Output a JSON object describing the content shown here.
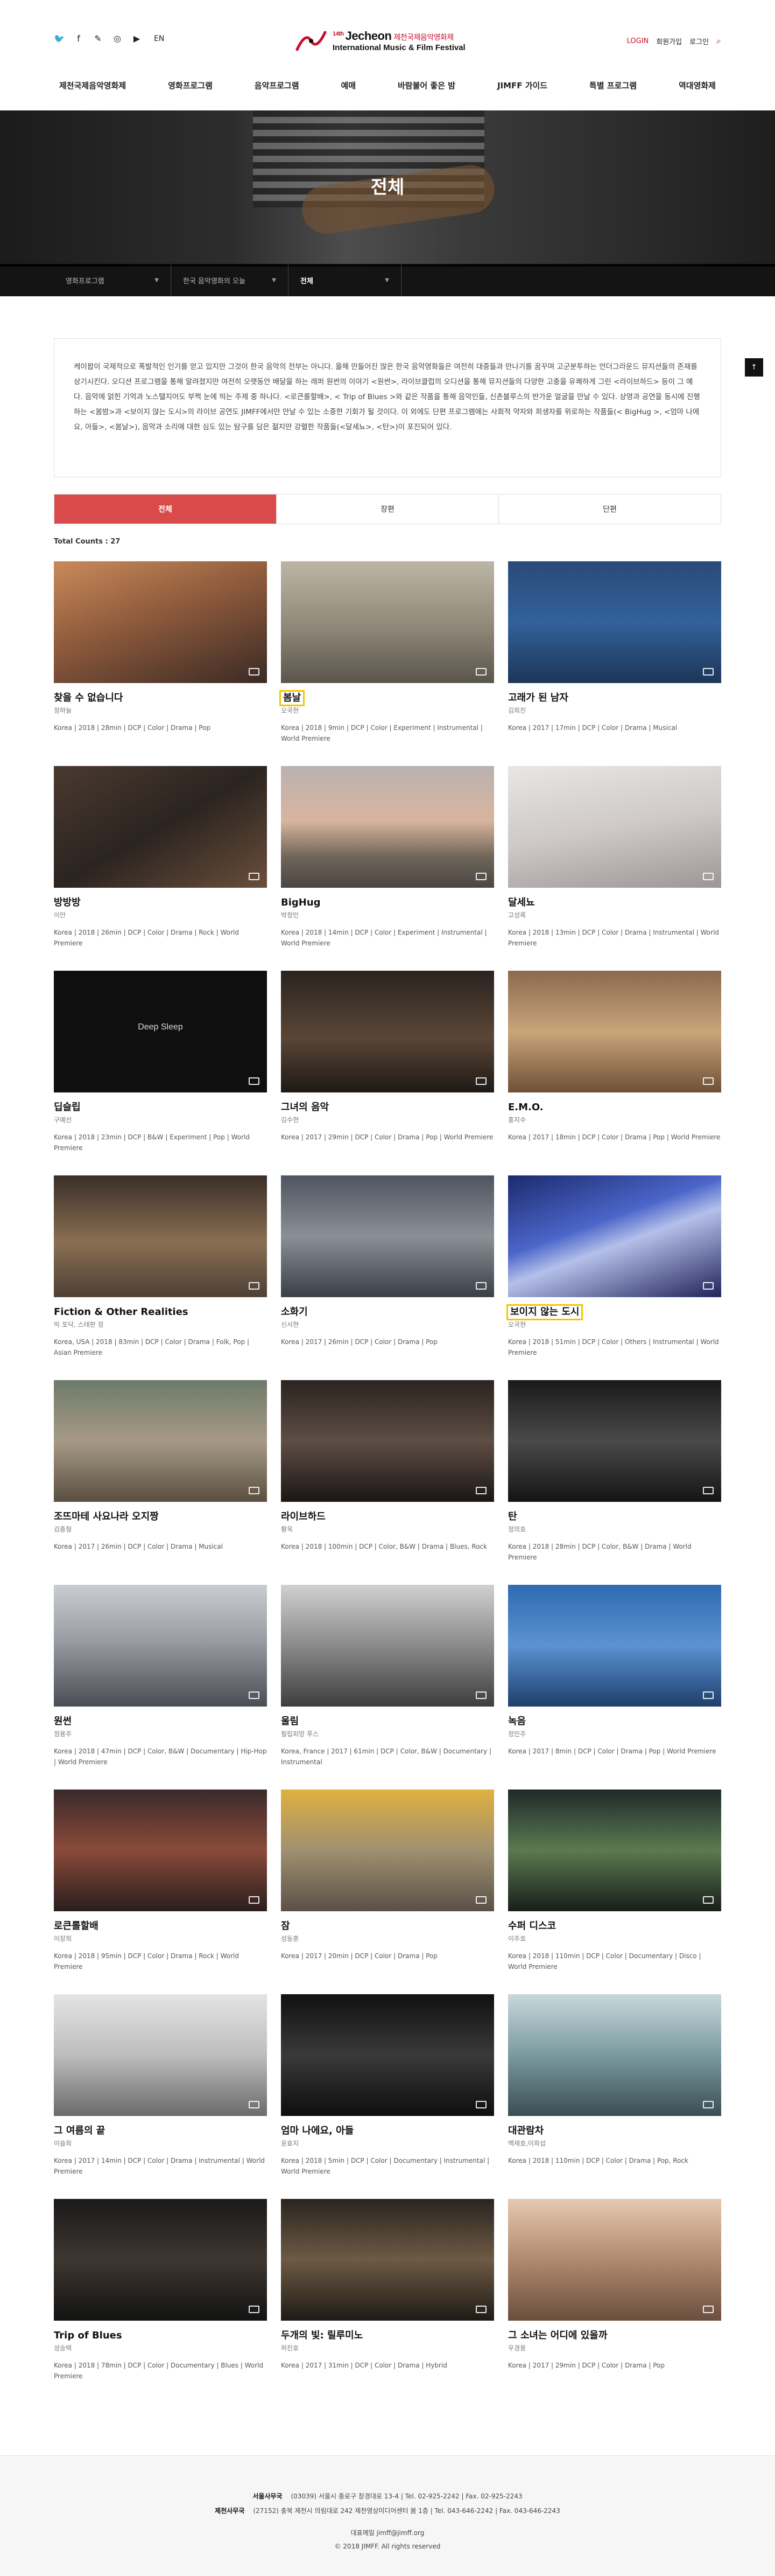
{
  "header": {
    "social": [
      "twitter-icon",
      "facebook-icon",
      "blog-icon",
      "instagram-icon",
      "youtube-icon"
    ],
    "lang": "EN",
    "logo": {
      "edition": "14th",
      "name": "Jecheon",
      "kor": "제천국제음악영화제",
      "sub": "International Music & Film Festival"
    },
    "util": {
      "login": "LOGIN",
      "join": "회원가입",
      "logout": "로그인"
    },
    "nav": [
      "제천국제음악영화제",
      "영화프로그램",
      "음악프로그램",
      "예매",
      "바람불어 좋은 밤",
      "JIMFF 가이드",
      "특별 프로그램",
      "역대영화제"
    ]
  },
  "hero": {
    "title": "전체"
  },
  "breadcrumb": {
    "level1": "영화프로그램",
    "level2": "한국 음악영화의 오늘",
    "level3": "전체"
  },
  "intro": {
    "text": "케이팝이 국제적으로 폭발적인 인기를 얻고 있지만 그것이 한국 음악의 전부는 아니다. 올해 만들어진 많은 한국 음악영화들은 여전히 대중들과 만나기를 꿈꾸며 고군분투하는 언더그라운드 뮤지션들의 존재를 상기시킨다. 오디션 프로그램을 통해 알려졌지만 여전히 오랫동안 배달을 하는 래퍼 원썬의 이야기 <원썬>, 라이브클럽의 오디션을 통해 뮤지션들의 다양한 고충을 유쾌하게 그린 <라이브하드> 등이 그 예다. 음악에 얽힌 기억과 노스탤지어도 부쩍 눈에 띄는 주제 중 하나다. <로큰롤할배>, < Trip of Blues >와 같은 작품을 통해 음악인들, 신촌블루스의 반가운 얼굴을 만날 수 있다. 상영과 공연을 동시에 진행하는 <봄밤>과 <보이지 않는 도시>의 라이브 공연도 JIMFF에서만 만날 수 있는 소중한 기회가 될 것이다. 이 외에도 단편 프로그램에는 사회적 약자와 희생자를 위로하는 작품들(< BigHug >, <엄마 나에요, 아들>, <봄날>), 음악과 소리에 대한 심도 있는 탐구를 담은 젊지만 강렬한 작품들(<달세뇨>, <탄>)이 포진되어 있다."
  },
  "tabs": [
    "전체",
    "장편",
    "단편"
  ],
  "total_label": "Total Counts : 27",
  "films": [
    {
      "title": "찾을 수 없습니다",
      "director": "정하늘",
      "meta": "Korea | 2018 | 28min | DCP | Color | Drama | Pop",
      "hl": false,
      "bg": "linear-gradient(160deg,#c98a5a 0%,#8e5a3c 45%,#3b2a24 100%)"
    },
    {
      "title": "봄날",
      "director": "오국현",
      "meta": "Korea | 2018 | 9min | DCP | Color | Experiment | Instrumental | World Premiere",
      "hl": true,
      "bg": "linear-gradient(180deg,#bdb6a6 0%,#8e8677 55%,#5a554b 100%)"
    },
    {
      "title": "고래가 된 남자",
      "director": "김희진",
      "meta": "Korea | 2017 | 17min | DCP | Color | Drama | Musical",
      "hl": false,
      "bg": "linear-gradient(180deg,#2a4a78 0%,#33619a 50%,#1c3658 100%)"
    },
    {
      "title": "방방방",
      "director": "이안",
      "meta": "Korea | 2018 | 26min | DCP | Color | Drama | Rock | World Premiere",
      "hl": false,
      "bg": "linear-gradient(150deg,#4a3a30 0%,#2b2420 50%,#6a4e3a 100%)"
    },
    {
      "title": "BigHug",
      "director": "박정민",
      "meta": "Korea | 2018 | 14min | DCP | Color | Experiment | Instrumental | World Premiere",
      "hl": false,
      "bg": "linear-gradient(180deg,#b9b2b0 0%,#d8b59e 45%,#6e6458 75%,#4a4642 100%)"
    },
    {
      "title": "달세뇨",
      "director": "고성록",
      "meta": "Korea | 2018 | 13min | DCP | Color | Drama | Instrumental | World Premiere",
      "hl": false,
      "bg": "linear-gradient(170deg,#e9e6e6 0%,#cfc9c9 50%,#9e9696 100%)"
    },
    {
      "title": "딥슬립",
      "director": "구예선",
      "meta": "Korea | 2018 | 23min | DCP | B&W | Experiment | Pop | World Premiere",
      "hl": false,
      "bg": "#0f0f0f",
      "overlay": "Deep Sleep"
    },
    {
      "title": "그녀의 음악",
      "director": "김수현",
      "meta": "Korea | 2017 | 29min | DCP | Color | Drama | Pop | World Premiere",
      "hl": false,
      "bg": "linear-gradient(180deg,#2a2320 0%,#5a4636 55%,#1e1916 100%)"
    },
    {
      "title": "E.M.O.",
      "director": "홍지수",
      "meta": "Korea | 2017 | 18min | DCP | Color | Drama | Pop | World Premiere",
      "hl": false,
      "bg": "linear-gradient(180deg,#8a6a4e 0%,#c9a57a 50%,#6e5038 100%)"
    },
    {
      "title": "Fiction & Other Realities",
      "director": "빅 포닥, 스테판 정",
      "meta": "Korea, USA | 2018 | 83min | DCP | Color | Drama | Folk, Pop | Asian Premiere",
      "hl": false,
      "bg": "linear-gradient(180deg,#3a2f28 0%,#8a6e52 55%,#4e4036 100%)"
    },
    {
      "title": "소화기",
      "director": "신서현",
      "meta": "Korea | 2017 | 26min | DCP | Color | Drama | Pop",
      "hl": false,
      "bg": "linear-gradient(180deg,#4e5560 0%,#8b8f96 50%,#3a3f47 100%)"
    },
    {
      "title": "보이지 않는 도시",
      "director": "오국현",
      "meta": "Korea | 2018 | 51min | DCP | Color | Others | Instrumental | World Premiere",
      "hl": true,
      "bg": "linear-gradient(160deg,#1c2a6e 0%,#4b66c9 40%,#b5c0ea 55%,#20245a 100%)"
    },
    {
      "title": "조뜨마테 사요나라 오지짱",
      "director": "김종형",
      "meta": "Korea | 2017 | 26min | DCP | Color | Drama | Musical",
      "hl": false,
      "bg": "linear-gradient(180deg,#6e7a6a 0%,#a69a86 50%,#5a4e40 100%)"
    },
    {
      "title": "라이브하드",
      "director": "황욱",
      "meta": "Korea | 2018 | 100min | DCP | Color, B&W | Drama | Blues, Rock",
      "hl": false,
      "bg": "linear-gradient(180deg,#2a2420 0%,#5e4e44 50%,#1a1614 100%)"
    },
    {
      "title": "탄",
      "director": "정의호",
      "meta": "Korea | 2018 | 28min | DCP | Color, B&W | Drama | World Premiere",
      "hl": false,
      "bg": "linear-gradient(180deg,#1a1a1a 0%,#4a4a4a 50%,#141414 100%)"
    },
    {
      "title": "원썬",
      "director": "정용주",
      "meta": "Korea | 2018 | 47min | DCP | Color, B&W | Documentary | Hip-Hop | World Premiere",
      "hl": false,
      "bg": "linear-gradient(180deg,#c9ccd0 0%,#9a9ea4 45%,#4a4e54 100%)"
    },
    {
      "title": "울림",
      "director": "필립피망 푸스",
      "meta": "Korea, France | 2017 | 61min | DCP | Color, B&W | Documentary | Instrumental",
      "hl": false,
      "bg": "linear-gradient(180deg,#d0d0d0 0%,#8a8a8a 50%,#3e3e3e 100%)"
    },
    {
      "title": "녹음",
      "director": "정민주",
      "meta": "Korea | 2017 | 8min | DCP | Color | Drama | Pop | World Premiere",
      "hl": false,
      "bg": "linear-gradient(180deg,#2e6ab3 0%,#5b92d0 50%,#1e3f6c 100%)"
    },
    {
      "title": "로큰롤할배",
      "director": "이장희",
      "meta": "Korea | 2018 | 95min | DCP | Color | Drama | Rock | World Premiere",
      "hl": false,
      "bg": "linear-gradient(180deg,#3a2a2a 0%,#8a4a3a 50%,#2a1e1e 100%)"
    },
    {
      "title": "잠",
      "director": "성동훈",
      "meta": "Korea | 2017 | 20min | DCP | Color | Drama | Pop",
      "hl": false,
      "bg": "linear-gradient(180deg,#e0b040 0%,#a09070 50%,#5a5048 100%)"
    },
    {
      "title": "수퍼 디스코",
      "director": "이주호",
      "meta": "Korea | 2018 | 110min | DCP | Color | Documentary | Disco | World Premiere",
      "hl": false,
      "bg": "linear-gradient(180deg,#1e2a2a 0%,#5a7a50 50%,#1a1e1a 100%)"
    },
    {
      "title": "그 여름의 끝",
      "director": "이슬희",
      "meta": "Korea | 2017 | 14min | DCP | Color | Drama | Instrumental | World Premiere",
      "hl": false,
      "bg": "linear-gradient(180deg,#e4e4e4 0%,#bdbdbd 50%,#6a6a6a 100%)"
    },
    {
      "title": "엄마 나에요, 아들",
      "director": "윤효지",
      "meta": "Korea | 2018 | 5min | DCP | Color | Documentary | Instrumental | World Premiere",
      "hl": false,
      "bg": "linear-gradient(180deg,#101010 0%,#3a3a3a 50%,#0e0e0e 100%)"
    },
    {
      "title": "대관람차",
      "director": "백재호,이희섭",
      "meta": "Korea | 2018 | 110min | DCP | Color | Drama | Pop, Rock",
      "hl": false,
      "bg": "linear-gradient(180deg,#c8d8dc 0%,#7a9aa0 50%,#3a4e52 100%)"
    },
    {
      "title": "Trip of Blues",
      "director": "성승택",
      "meta": "Korea | 2018 | 78min | DCP | Color | Documentary | Blues | World Premiere",
      "hl": false,
      "bg": "linear-gradient(180deg,#1a1a1a 0%,#3e3630 50%,#121212 100%)"
    },
    {
      "title": "두개의 빛: 릴루미노",
      "director": "허진호",
      "meta": "Korea | 2017 | 31min | DCP | Color | Drama | Hybrid",
      "hl": false,
      "bg": "linear-gradient(180deg,#2a2420 0%,#6e5a44 50%,#1e1a16 100%)"
    },
    {
      "title": "그 소녀는 어디에 있을까",
      "director": "우경용",
      "meta": "Korea | 2017 | 29min | DCP | Color | Drama | Pop",
      "hl": false,
      "bg": "linear-gradient(180deg,#e6c8b0 0%,#b08a6e 50%,#6a4e3e 100%)"
    }
  ],
  "footer": {
    "seoul_label": "서울사무국",
    "seoul": "(03039) 서울시 종로구 창경대로 13-4 | Tel. 02-925-2242 | Fax. 02-925-2243",
    "jecheon_label": "제천사무국",
    "jecheon": "(27152) 충북 제천시 의림대로 242 제천영상미디어센터 봄 1층 | Tel. 043-646-2242 | Fax. 043-646-2243",
    "email": "대표메일 jimff@jimff.org",
    "copyright": "© 2018 JIMFF. All rights reserved"
  },
  "colors": {
    "accent": "#d94a4a",
    "brand": "#c8102e",
    "highlight": "#f2c400"
  }
}
